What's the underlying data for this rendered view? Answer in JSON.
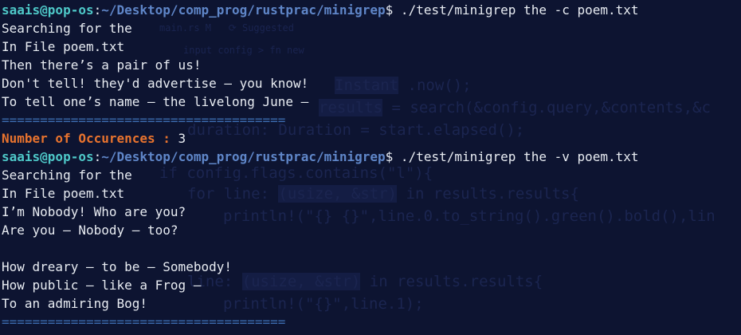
{
  "terminal": {
    "command1": {
      "user_host": "saais@pop-os",
      "separator": ":",
      "path": "~/Desktop/comp_prog/rustprac/minigrep",
      "symbol": "$",
      "command": " ./test/minigrep the -c poem.txt"
    },
    "output1": [
      "Searching for the",
      "In File poem.txt",
      "Then there’s a pair of us!",
      "Don't tell! they'd advertise – you know!",
      "To tell one’s name – the livelong June –"
    ],
    "divider": "=====================================",
    "occurrences_label": "Number of Occurences :",
    "occurrences_value": " 3",
    "command2": {
      "user_host": "saais@pop-os",
      "separator": ":",
      "path": "~/Desktop/comp_prog/rustprac/minigrep",
      "symbol": "$",
      "command": " ./test/minigrep the -v poem.txt"
    },
    "output2a": [
      "Searching for the",
      "In File poem.txt",
      "I’m Nobody! Who are you?",
      "Are you – Nobody – too?"
    ],
    "output2b": [
      "How dreary – to be – Somebody!",
      "How public – like a Frog –",
      "To an admiring Bog!"
    ],
    "divider2": "====================================="
  }
}
